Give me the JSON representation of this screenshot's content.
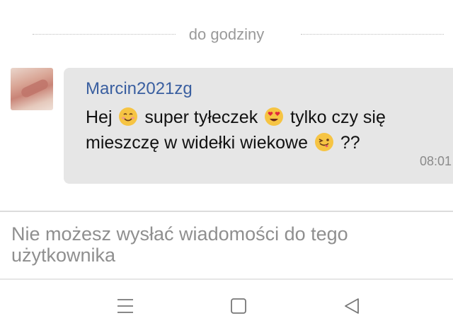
{
  "divider": {
    "label": "do godziny"
  },
  "message": {
    "sender": "Marcin2021zg",
    "line1_a": "Hej",
    "line1_b": "super tyłeczek",
    "line1_c": "tylko czy się",
    "line2_a": "mieszczę w widełki wiekowe",
    "line2_b": "??",
    "time": "08:01",
    "emojis": [
      "smiling-face-icon",
      "heart-eyes-icon",
      "winking-tongue-icon"
    ]
  },
  "input": {
    "notice": "Nie możesz wysłać wiadomości do tego użytkownika"
  },
  "nav": {
    "icons": [
      "menu-icon",
      "home-square-icon",
      "back-triangle-icon"
    ]
  },
  "colors": {
    "sender": "#3a5fa0",
    "bubble": "#e6e6e6",
    "emoji": "#f6c443"
  }
}
